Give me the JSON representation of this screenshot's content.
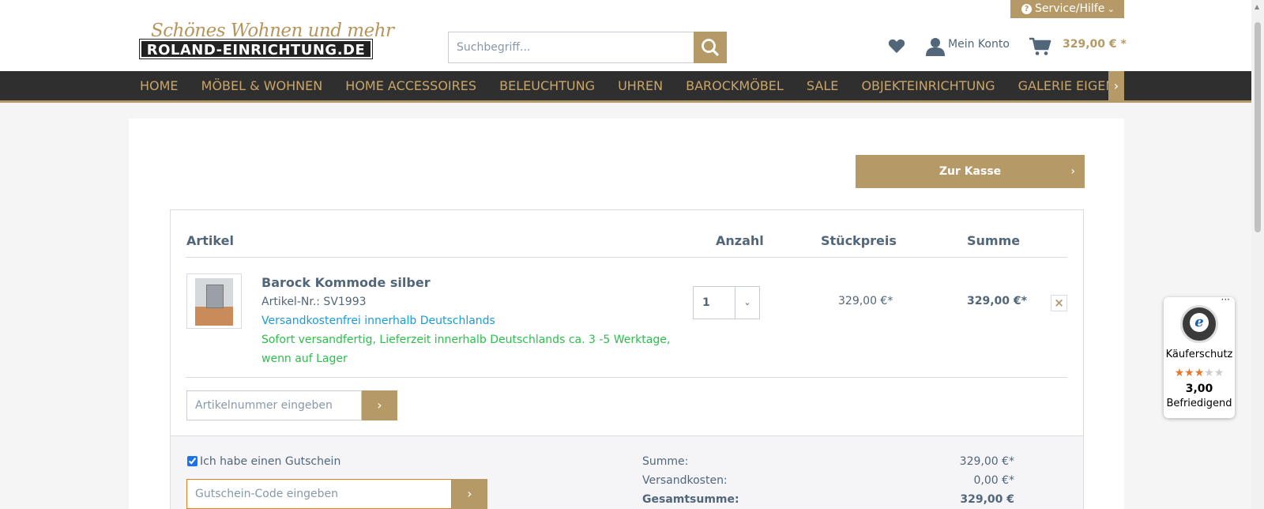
{
  "header": {
    "logo_script": "Schönes Wohnen und mehr",
    "logo_main": "ROLAND-EINRICHTUNG.DE",
    "service_label": "Service/Hilfe",
    "search_placeholder": "Suchbegriff...",
    "account_label": "Mein Konto",
    "cart_total": "329,00 € *"
  },
  "nav": {
    "items": [
      "HOME",
      "MÖBEL & WOHNEN",
      "HOME ACCESSOIRES",
      "BELEUCHTUNG",
      "UHREN",
      "BAROCKMÖBEL",
      "SALE",
      "OBJEKTEINRICHTUNG",
      "GALERIE EIGENPRODUKTE"
    ]
  },
  "checkout": {
    "button_label": "Zur Kasse"
  },
  "cart": {
    "columns": {
      "article": "Artikel",
      "quantity": "Anzahl",
      "unit_price": "Stückpreis",
      "total": "Summe"
    },
    "item": {
      "name": "Barock Kommode silber",
      "article_no": "Artikel-Nr.: SV1993",
      "shipping": "Versandkostenfrei innerhalb Deutschlands",
      "delivery_line1": "Sofort versandfertig, Lieferzeit innerhalb Deutschlands ca. 3 -5 Werktage,",
      "delivery_line2": "wenn auf Lager",
      "quantity": "1",
      "unit_price": "329,00 €*",
      "total": "329,00 €*"
    },
    "article_input_placeholder": "Artikelnummer eingeben"
  },
  "voucher": {
    "checkbox_label": "Ich habe einen Gutschein",
    "checked": true,
    "input_placeholder": "Gutschein-Code eingeben"
  },
  "summary": {
    "subtotal_label": "Summe:",
    "subtotal_value": "329,00 €*",
    "shipping_label": "Versandkosten:",
    "shipping_value": "0,00 €*",
    "total_label": "Gesamtsumme:",
    "total_value": "329,00 €"
  },
  "trusted_shops": {
    "protection_label": "Käuferschutz",
    "score": "3,00",
    "rating_label": "Befriedigend",
    "stars_filled": 3,
    "stars_total": 5
  },
  "colors": {
    "accent": "#b59a67",
    "nav_bg": "#2f2f2f",
    "nav_text": "#c9a56a",
    "text": "#52667a",
    "link_blue": "#1a9bd7",
    "delivery_green": "#2dbe4b"
  }
}
